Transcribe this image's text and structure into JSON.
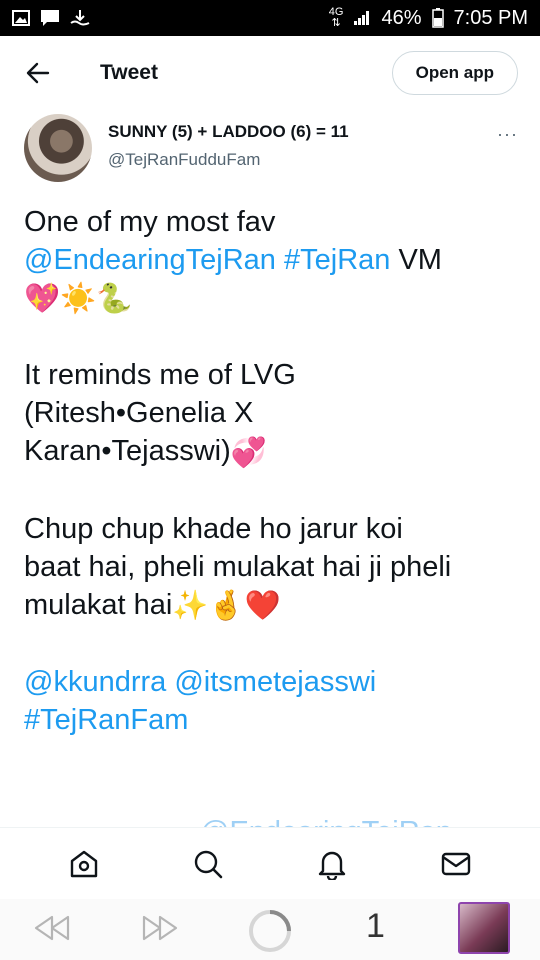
{
  "status_bar": {
    "network": "4G",
    "battery": "46%",
    "time": "7:05 PM",
    "left_icons": [
      "image-icon",
      "chat-icon",
      "download-icon"
    ]
  },
  "header": {
    "title": "Tweet",
    "open_app_label": "Open app",
    "back_icon": "arrow-left-icon"
  },
  "author": {
    "display_name": "SUNNY (5) + LADDOO (6) = 11",
    "handle": "@TejRanFudduFam",
    "more": "···"
  },
  "tweet": {
    "p1_line1": "One of my most fav",
    "p1_mention": "@EndearingTejRan",
    "p1_hashtag": "#TejRan",
    "p1_text": " VM",
    "p1_emojis": "💖☀️🐍",
    "p2_line1": "It reminds me of LVG",
    "p2_line2": "(Ritesh•Genelia X",
    "p2_line3": "Karan•Tejasswi)",
    "p2_emoji": "💞",
    "p3_line1": "Chup chup khade ho jarur koi",
    "p3_line2": "baat hai, pheli mulakat hai ji pheli",
    "p3_line3": "mulakat hai",
    "p3_emojis": "✨🤞❤️",
    "p4_mention1": "@kkundrra",
    "p4_mention2": "@itsmetejasswi",
    "p4_hashtag": "#TejRanFam",
    "faded_mention": "@EndearingTejRan"
  },
  "tabbar": {
    "items": [
      "home-icon",
      "search-icon",
      "notifications-icon",
      "messages-icon"
    ]
  },
  "browser_bar": {
    "tab_count": "1"
  },
  "colors": {
    "link": "#1d9bf0",
    "text": "#0f1419",
    "secondary": "#536471"
  }
}
